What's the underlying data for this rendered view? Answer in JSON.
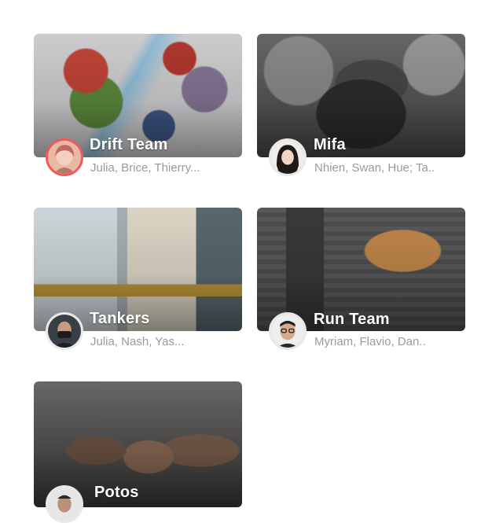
{
  "groups": [
    {
      "name": "Drift Team",
      "members": "Julia, Brice, Thierry...",
      "cover": "cartoon-superheroes",
      "avatar_border": "#ef5a5a"
    },
    {
      "name": "Mifa",
      "members": "Nhien, Swan, Hue; Ta..",
      "cover": "child-in-ny-cap",
      "avatar_border": "#e9e9e9"
    },
    {
      "name": "Tankers",
      "members": "Julia, Nash, Yas...",
      "cover": "office-interior",
      "avatar_border": "#e9e9e9"
    },
    {
      "name": "Run Team",
      "members": "Myriam, Flavio, Dan..",
      "cover": "running-shoes-and-phone",
      "avatar_border": "#e9e9e9"
    },
    {
      "name": "Potos",
      "members": "",
      "cover": "group-of-men",
      "avatar_border": "#e9e9e9"
    }
  ]
}
